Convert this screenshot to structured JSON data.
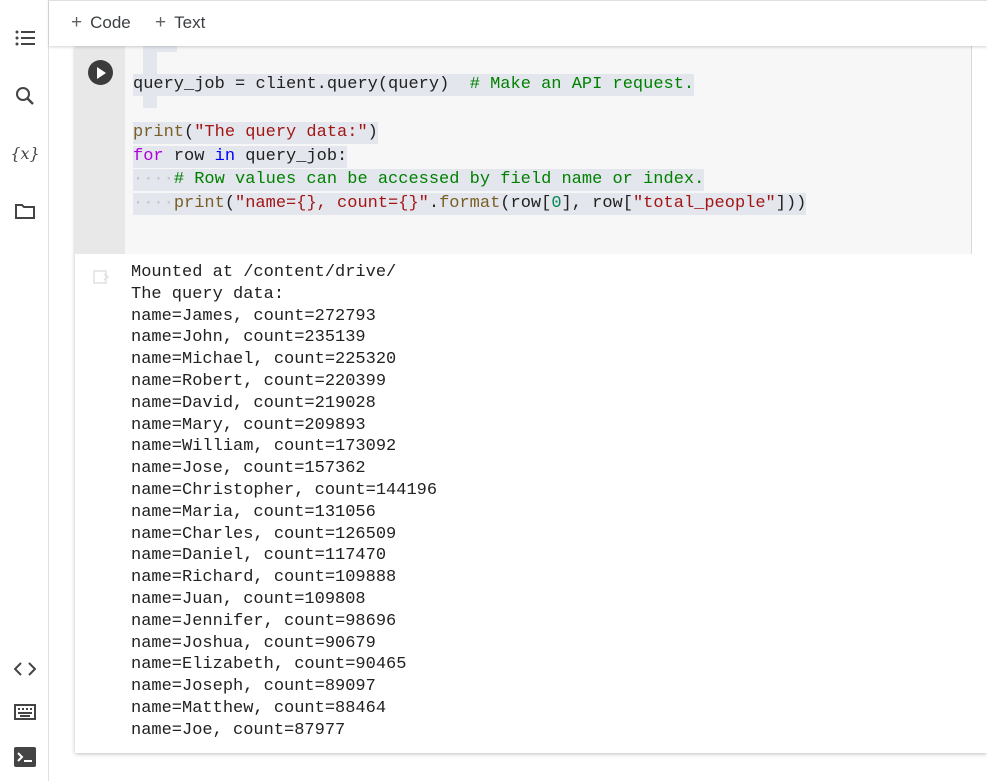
{
  "sidebar": {
    "icons": [
      "table-of-contents-icon",
      "search-icon",
      "variables-icon",
      "files-icon",
      "code-snippets-icon",
      "command-palette-icon",
      "terminal-icon"
    ],
    "variables_glyph": "{x}"
  },
  "toolbar": {
    "code_label": "Code",
    "text_label": "Text",
    "plus": "+"
  },
  "cell": {
    "code": {
      "line1": {
        "a": "query_job",
        "b": " = ",
        "c": "client.query(query)",
        "d": "  ",
        "e": "# Make an API request."
      },
      "line2": {
        "fn": "print",
        "p1": "(",
        "str": "\"The query data:\"",
        "p2": ")"
      },
      "line3": {
        "kw": "for",
        "v1": " row ",
        "in": "in",
        "v2": " query_job:"
      },
      "line4": {
        "indent": "····",
        "cm": "# Row values can be accessed by field name or index."
      },
      "line5": {
        "indent": "····",
        "fn": "print",
        "p1": "(",
        "s1": "\"name={}, count={}\"",
        "p2": ".",
        "fmt": "format",
        "p3": "(row[",
        "n0": "0",
        "p4": "], row[",
        "s2": "\"total_people\"",
        "p5": "]))"
      }
    },
    "output_lines": [
      "Mounted at /content/drive/",
      "The query data:",
      "name=James, count=272793",
      "name=John, count=235139",
      "name=Michael, count=225320",
      "name=Robert, count=220399",
      "name=David, count=219028",
      "name=Mary, count=209893",
      "name=William, count=173092",
      "name=Jose, count=157362",
      "name=Christopher, count=144196",
      "name=Maria, count=131056",
      "name=Charles, count=126509",
      "name=Daniel, count=117470",
      "name=Richard, count=109888",
      "name=Juan, count=109808",
      "name=Jennifer, count=98696",
      "name=Joshua, count=90679",
      "name=Elizabeth, count=90465",
      "name=Joseph, count=89097",
      "name=Matthew, count=88464",
      "name=Joe, count=87977"
    ]
  }
}
